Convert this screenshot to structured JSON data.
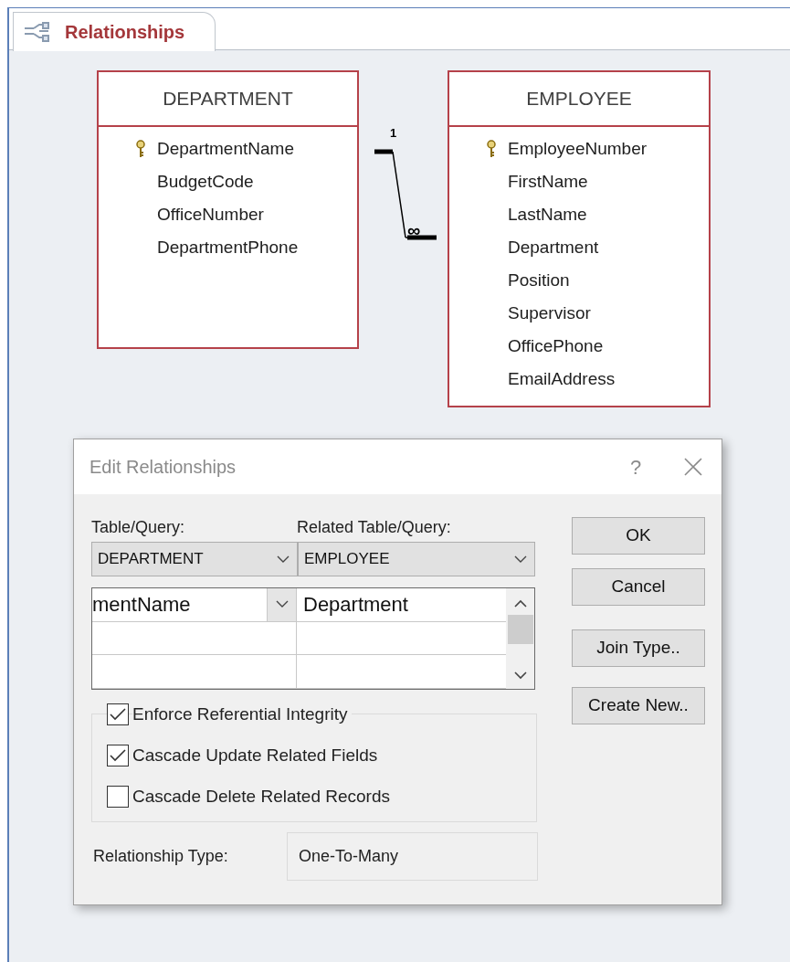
{
  "tab": {
    "label": "Relationships",
    "selected": true
  },
  "tables": [
    {
      "name": "DEPARTMENT",
      "fields": [
        {
          "name": "DepartmentName",
          "primary_key": true
        },
        {
          "name": "BudgetCode",
          "primary_key": false
        },
        {
          "name": "OfficeNumber",
          "primary_key": false
        },
        {
          "name": "DepartmentPhone",
          "primary_key": false
        }
      ]
    },
    {
      "name": "EMPLOYEE",
      "fields": [
        {
          "name": "EmployeeNumber",
          "primary_key": true
        },
        {
          "name": "FirstName",
          "primary_key": false
        },
        {
          "name": "LastName",
          "primary_key": false
        },
        {
          "name": "Department",
          "primary_key": false
        },
        {
          "name": "Position",
          "primary_key": false
        },
        {
          "name": "Supervisor",
          "primary_key": false
        },
        {
          "name": "OfficePhone",
          "primary_key": false
        },
        {
          "name": "EmailAddress",
          "primary_key": false
        }
      ]
    }
  ],
  "relationship": {
    "one_label": "1",
    "many_label": "∞"
  },
  "dialog": {
    "title": "Edit Relationships",
    "help": "?",
    "table_query": {
      "label": "Table/Query:",
      "value": "DEPARTMENT"
    },
    "related_table_query": {
      "label": "Related Table/Query:",
      "value": "EMPLOYEE"
    },
    "field_rows": [
      {
        "field": "mentName",
        "related_field": "Department"
      },
      {},
      {}
    ],
    "options": [
      {
        "label": "Enforce Referential Integrity",
        "checked": true
      },
      {
        "label": "Cascade Update Related Fields",
        "checked": true
      },
      {
        "label": "Cascade Delete Related Records",
        "checked": false
      }
    ],
    "relationship_type": {
      "label": "Relationship Type:",
      "value": "One-To-Many"
    },
    "buttons": [
      "OK",
      "Cancel",
      "Join Type..",
      "Create New.."
    ]
  }
}
